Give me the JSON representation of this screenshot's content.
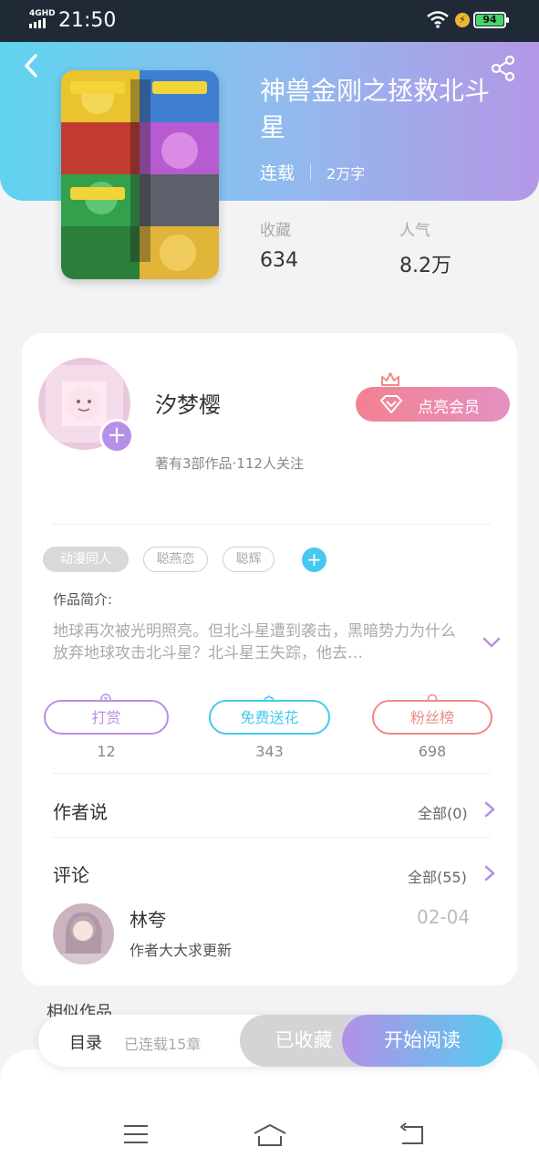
{
  "status_bar": {
    "network": "4GHD",
    "time": "21:50",
    "battery": "94"
  },
  "book": {
    "title": "神兽金刚之拯救北斗星",
    "status": "连载",
    "word_count": "2万字",
    "stats": [
      {
        "label": "收藏",
        "value": "634"
      },
      {
        "label": "人气",
        "value": "8.2万"
      }
    ]
  },
  "author": {
    "name": "汐梦樱",
    "info": "著有3部作品·112人关注",
    "follow_label": "+",
    "vip_label": "点亮会员"
  },
  "tags": [
    "动漫同人",
    "聪燕恋",
    "聪辉"
  ],
  "tag_add_label": "+",
  "intro": {
    "label": "作品简介:",
    "text": "地球再次被光明照亮。但北斗星遭到袭击，黑暗势力为什么放弃地球攻击北斗星？北斗星王失踪，他去…"
  },
  "actions": [
    {
      "label": "打赏",
      "count": "12"
    },
    {
      "label": "免费送花",
      "count": "343"
    },
    {
      "label": "粉丝榜",
      "count": "698"
    }
  ],
  "author_says": {
    "title": "作者说",
    "link": "全部(0)"
  },
  "comments": {
    "title": "评论",
    "link": "全部(55)",
    "items": [
      {
        "user": "林夸",
        "date": "02-04",
        "text": "作者大大求更新"
      }
    ]
  },
  "similar_title": "相似作品",
  "action_bar": {
    "toc": "目录",
    "chapters": "已连载15章",
    "collected": "已收藏",
    "read": "开始阅读"
  },
  "colors": {
    "accent_cyan": "#45c9ef",
    "accent_purple": "#b690e8",
    "accent_pink": "#ee8b86"
  }
}
